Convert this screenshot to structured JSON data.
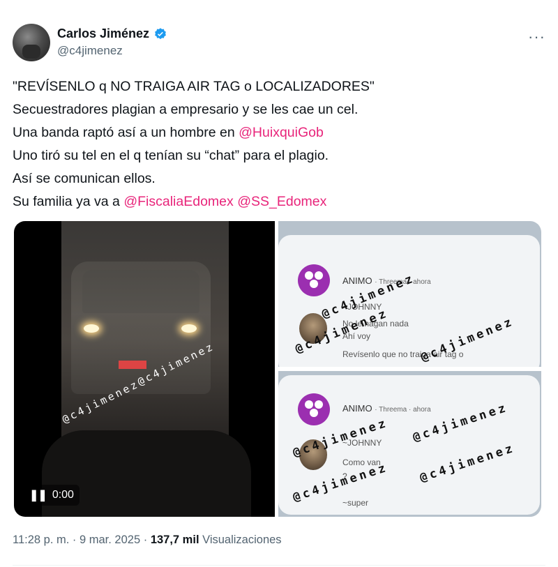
{
  "author": {
    "display_name": "Carlos Jiménez",
    "handle": "@c4jimenez",
    "verified_icon": "verified-badge-icon"
  },
  "more_label": "···",
  "tweet_lines": [
    {
      "text": "\"REVÍSENLO q NO TRAIGA AIR TAG o LOCALIZADORES\""
    },
    {
      "text": "Secuestradores plagian a empresario y se les cae un cel."
    },
    {
      "text": "Una banda raptó así a un hombre en ",
      "mention": "@HuixquiGob"
    },
    {
      "text": "Uno tiró su tel en el q tenían su “chat” para el plagio."
    },
    {
      "text": "Así se comunican ellos."
    },
    {
      "text": "Su familia ya va a ",
      "mention": "@FiscaliaEdomex",
      "mention2": "@SS_Edomex"
    }
  ],
  "media": {
    "watermark": "@c4jimenez",
    "video_time": "0:00",
    "top_card": {
      "app_name": "ANIMO",
      "app_meta": "· Threema · ahora",
      "sender": "~JOHNNY",
      "messages": [
        "No le hagan nada",
        "Ahí voy",
        "Revísenlo que no traiga air tag o"
      ]
    },
    "bottom_card": {
      "app_name": "ANIMO",
      "app_meta": "· Threema · ahora",
      "sender": "~JOHNNY",
      "messages": [
        "Como van",
        "?",
        "~super"
      ]
    }
  },
  "footer": {
    "time": "11:28 p. m.",
    "sep1": " · ",
    "date": "9 mar. 2025",
    "sep2": " · ",
    "views_count": "137,7 mil",
    "views_label": " Visualizaciones"
  },
  "colors": {
    "mention": "#e8247a",
    "verified": "#1d9bf0",
    "muted": "#536471"
  }
}
